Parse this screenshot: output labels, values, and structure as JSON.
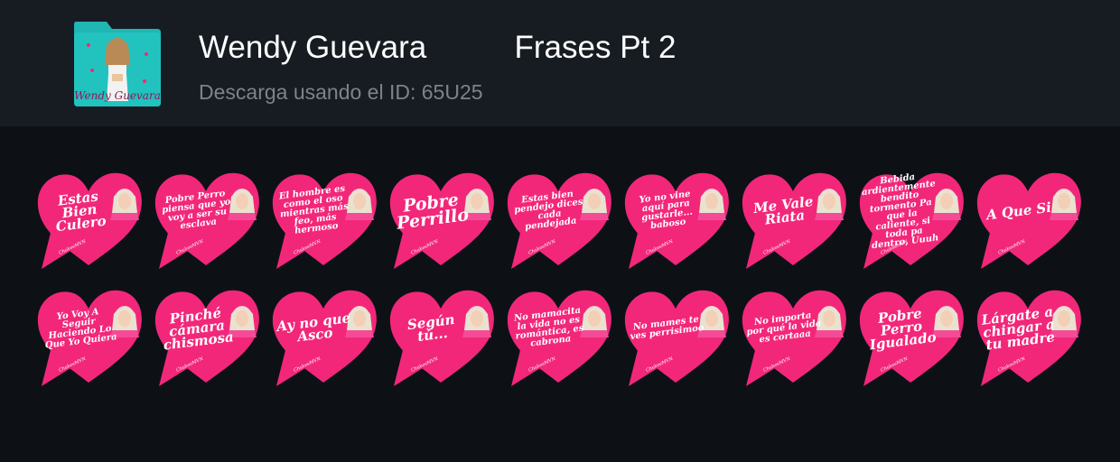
{
  "pack": {
    "title": "Wendy Guevara          Frases Pt 2",
    "subtitle": "Descarga usando el ID: 65U25",
    "icon_name": "sticker-pack-folder-icon",
    "icon_text": "Wendy Guevara"
  },
  "colors": {
    "heart": "#f2277a",
    "header_bg": "#161c22",
    "page_bg": "#0d1116"
  },
  "stickers": [
    {
      "text": "Estas Bien Culero",
      "size": "med"
    },
    {
      "text": "Pobre Perro piensa que yo voy a ser su esclava",
      "size": "small"
    },
    {
      "text": "El hombre es como el oso mientras más feo, más hermoso",
      "size": "small"
    },
    {
      "text": "Pobre Perrillo",
      "size": "big"
    },
    {
      "text": "Estas bien pendejo dices cada pendejada",
      "size": "small"
    },
    {
      "text": "Yo no vine aquí para gustarle... baboso",
      "size": "small"
    },
    {
      "text": "Me Vale Riata",
      "size": "med"
    },
    {
      "text": "Bebida ardientemente bendito tormento Pa que la caliente, si toda pa dentro, Uuuh",
      "size": "small"
    },
    {
      "text": "A Que Si",
      "size": "med"
    },
    {
      "text": "Yo Voy A Seguir Haciendo Lo Que Yo Quiera",
      "size": "small"
    },
    {
      "text": "Pinché cámara chismosa",
      "size": "med"
    },
    {
      "text": "Ay no que Asco",
      "size": "med"
    },
    {
      "text": "Según tú...",
      "size": "med"
    },
    {
      "text": "No mamacita la vida no es romántica, es cabrona",
      "size": "small"
    },
    {
      "text": "No mames te ves perrisimoo",
      "size": "small"
    },
    {
      "text": "No importa por qué la vida es cortaaa",
      "size": "small"
    },
    {
      "text": "Pobre Perro Igualado",
      "size": "med"
    },
    {
      "text": "Lárgate a chingar a tu madre",
      "size": "med"
    }
  ]
}
